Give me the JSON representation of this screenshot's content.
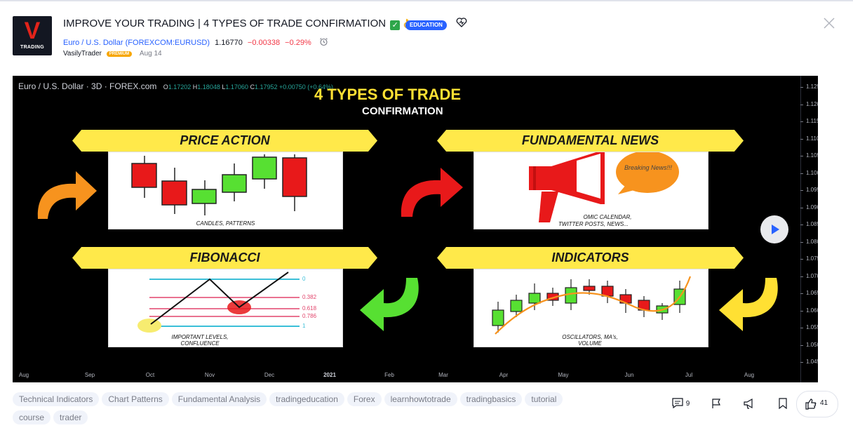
{
  "header": {
    "logo_letter": "V",
    "logo_text": "TRADING",
    "title": "IMPROVE YOUR TRADING | 4 TYPES OF TRADE CONFIRMATION",
    "badge": "EDUCATION",
    "symbol": "Euro / U.S. Dollar (FOREXCOM:EURUSD)",
    "price": "1.16770",
    "change": "−0.00338",
    "change_pct": "−0.29%",
    "author": "VasilyTrader",
    "author_badge": "PREMIUM",
    "date": "Aug 14",
    "icons": [
      "check-emoji-icon",
      "ok-hand-emoji-icon",
      "heart-icon",
      "close-icon",
      "alarm-clock-icon"
    ]
  },
  "chart": {
    "legend_title": "Euro / U.S. Dollar · 3D · FOREX.com",
    "o_label": "O",
    "o_val": "1.17202",
    "h_label": "H",
    "h_val": "1.18048",
    "l_label": "L",
    "l_val": "1.17060",
    "c_label": "C",
    "c_val": "1.17952",
    "chg": "+0.00750 (+0.64%)",
    "y_ticks": [
      "1.12500",
      "1.12000",
      "1.11500",
      "1.11000",
      "1.10500",
      "1.10000",
      "1.09500",
      "1.09000",
      "1.08500",
      "1.08000",
      "1.07500",
      "1.07000",
      "1.06500",
      "1.06000",
      "1.05500",
      "1.05000",
      "1.04500"
    ],
    "x_ticks": [
      "Aug",
      "Sep",
      "Oct",
      "Nov",
      "Dec",
      "2021",
      "Feb",
      "Mar",
      "Apr",
      "May",
      "Jun",
      "Jul",
      "Aug"
    ],
    "colors": {
      "bull": "#57e032",
      "bear": "#e8191a",
      "banner": "#ffe94a",
      "heading": "#ffe033"
    }
  },
  "overlay": {
    "heading": "4 TYPES OF TRADE",
    "subheading": "CONFIRMATION",
    "price_action": {
      "title": "PRICE ACTION",
      "caption": "CANDLES, PATTERNS"
    },
    "fundamental": {
      "title": "FUNDAMENTAL NEWS",
      "bubble": "Breaking News!!!",
      "caption1": "OMIC CALENDAR,",
      "caption2": "TWITTER POSTS, NEWS..."
    },
    "fibonacci": {
      "title": "FIBONACCI",
      "levels": [
        "0",
        "0.382",
        "0.618",
        "0.786",
        "1"
      ],
      "caption1": "IMPORTANT LEVELS,",
      "caption2": "CONFLUENCE"
    },
    "indicators": {
      "title": "INDICATORS",
      "caption1": "OSCILLATORS, MA's,",
      "caption2": "VOLUME"
    }
  },
  "tags": [
    "Technical Indicators",
    "Chart Patterns",
    "Fundamental Analysis",
    "tradingeducation",
    "Forex",
    "learnhowtotrade",
    "tradingbasics",
    "tutorial",
    "course",
    "trader"
  ],
  "actions": {
    "comments": "9",
    "likes": "41"
  }
}
